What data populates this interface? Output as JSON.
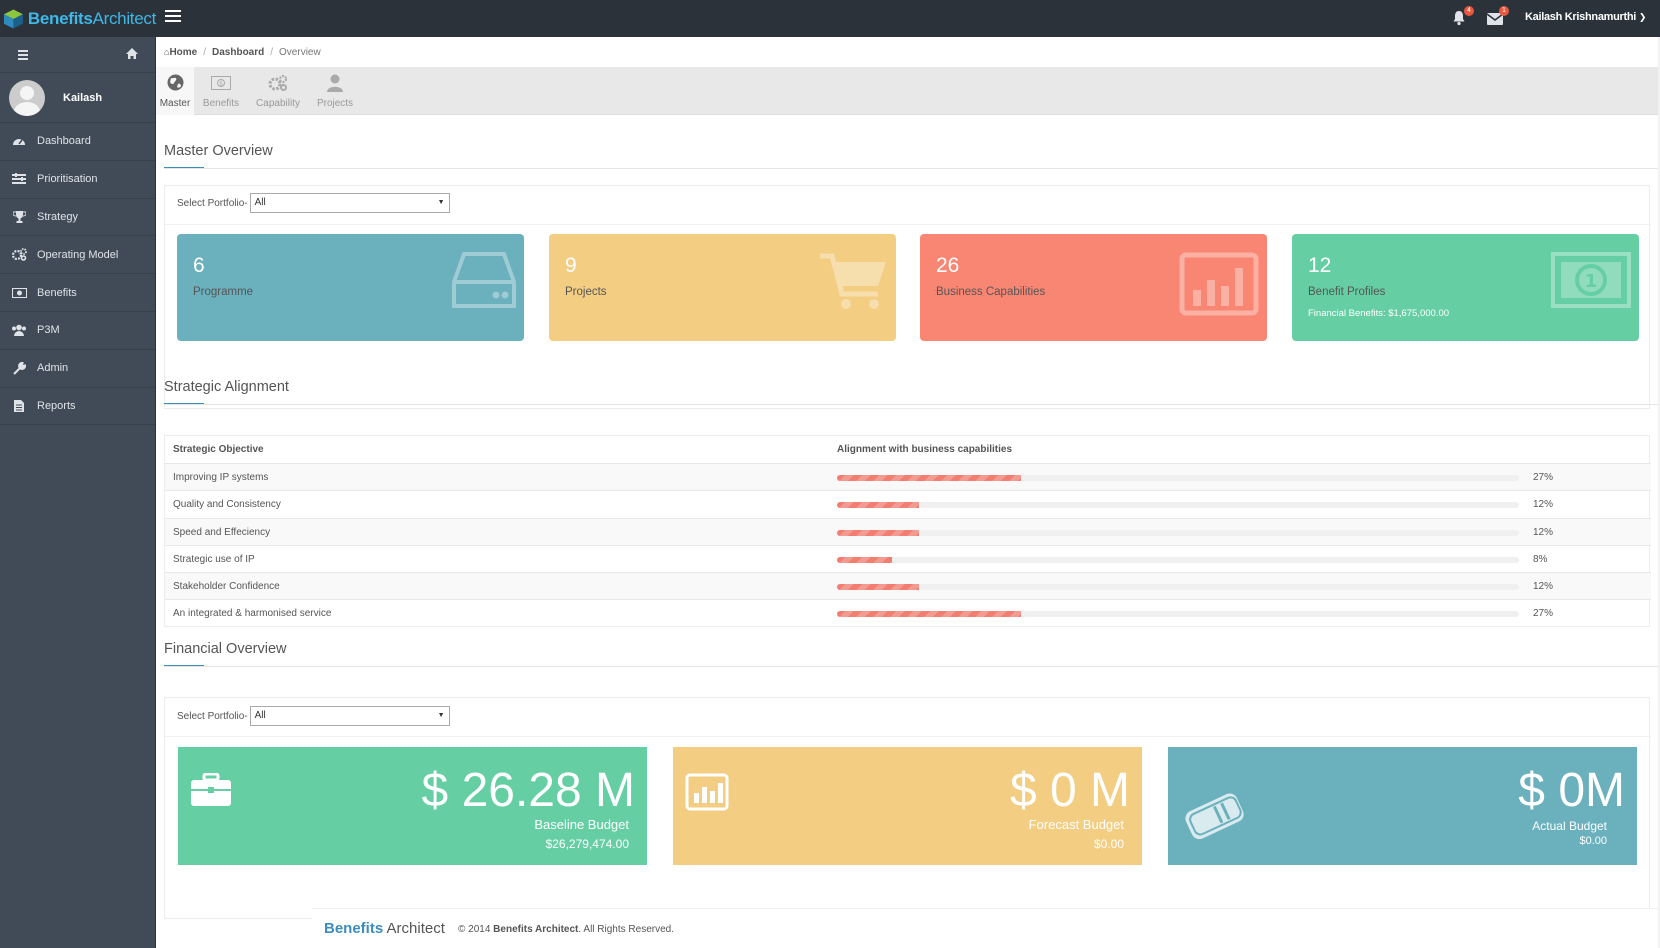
{
  "header": {
    "brand_part1": "Benefits",
    "brand_part2": "Architect",
    "notifications_count": "4",
    "messages_count": "1",
    "user_name": "Kailash Krishnamurthi"
  },
  "sidebar": {
    "user_name": "Kailash",
    "items": [
      {
        "label": "Dashboard",
        "icon": "dashboard-icon"
      },
      {
        "label": "Prioritisation",
        "icon": "list-icon"
      },
      {
        "label": "Strategy",
        "icon": "trophy-icon"
      },
      {
        "label": "Operating Model",
        "icon": "gears-icon"
      },
      {
        "label": "Benefits",
        "icon": "money-icon"
      },
      {
        "label": "P3M",
        "icon": "users-icon"
      },
      {
        "label": "Admin",
        "icon": "wrench-icon"
      },
      {
        "label": "Reports",
        "icon": "file-icon"
      }
    ]
  },
  "breadcrumb": {
    "home": "Home",
    "dashboard": "Dashboard",
    "current": "Overview"
  },
  "tabs": [
    {
      "label": "Master",
      "icon": "globe-icon",
      "active": true
    },
    {
      "label": "Benefits",
      "icon": "money-icon",
      "active": false
    },
    {
      "label": "Capability",
      "icon": "gears-icon",
      "active": false
    },
    {
      "label": "Projects",
      "icon": "user-icon",
      "active": false
    }
  ],
  "master_overview": {
    "title": "Master Overview",
    "select_label": "Select Portfolio-",
    "select_value": "All",
    "cards": [
      {
        "number": "6",
        "label": "Programme",
        "sub": "",
        "color": "#6ab0bd",
        "icon": "hdd-icon"
      },
      {
        "number": "9",
        "label": "Projects",
        "sub": "",
        "color": "#f3cd82",
        "icon": "cart-icon"
      },
      {
        "number": "26",
        "label": "Business Capabilities",
        "sub": "",
        "color": "#f98673",
        "icon": "bar-chart-icon"
      },
      {
        "number": "12",
        "label": "Benefit Profiles",
        "sub": "Financial Benefits: $1,675,000.00",
        "color": "#65cfa3",
        "icon": "money-icon"
      }
    ]
  },
  "strategic_alignment": {
    "title": "Strategic Alignment",
    "col_objective": "Strategic Objective",
    "col_alignment": "Alignment with business capabilities",
    "rows": [
      {
        "objective": "Improving IP systems",
        "percent": 27,
        "percent_label": "27%"
      },
      {
        "objective": "Quality and Consistency",
        "percent": 12,
        "percent_label": "12%"
      },
      {
        "objective": "Speed and Effeciency",
        "percent": 12,
        "percent_label": "12%"
      },
      {
        "objective": "Strategic use of IP",
        "percent": 8,
        "percent_label": "8%"
      },
      {
        "objective": "Stakeholder Confidence",
        "percent": 12,
        "percent_label": "12%"
      },
      {
        "objective": "An integrated & harmonised service",
        "percent": 27,
        "percent_label": "27%"
      }
    ]
  },
  "financial_overview": {
    "title": "Financial Overview",
    "select_label": "Select Portfolio-",
    "select_value": "All",
    "cards": [
      {
        "amount": "$ 26.28 M",
        "label": "Baseline Budget",
        "sub": "$26,279,474.00",
        "color": "#65cfa3",
        "icon": "briefcase-icon"
      },
      {
        "amount": "$ 0 M",
        "label": "Forecast Budget",
        "sub": "$0.00",
        "color": "#f3cd82",
        "icon": "bar-chart-icon"
      },
      {
        "amount": "$ 0M",
        "label": "Actual Budget",
        "sub": "$0.00",
        "color": "#6ab0bd",
        "icon": "money-roll-icon"
      }
    ]
  },
  "footer": {
    "brand_part1": "Benefits",
    "brand_part2": "Architect",
    "copy_prefix": "© 2014 ",
    "copy_brand": "Benefits Architect",
    "copy_suffix": ". All Rights Reserved."
  }
}
